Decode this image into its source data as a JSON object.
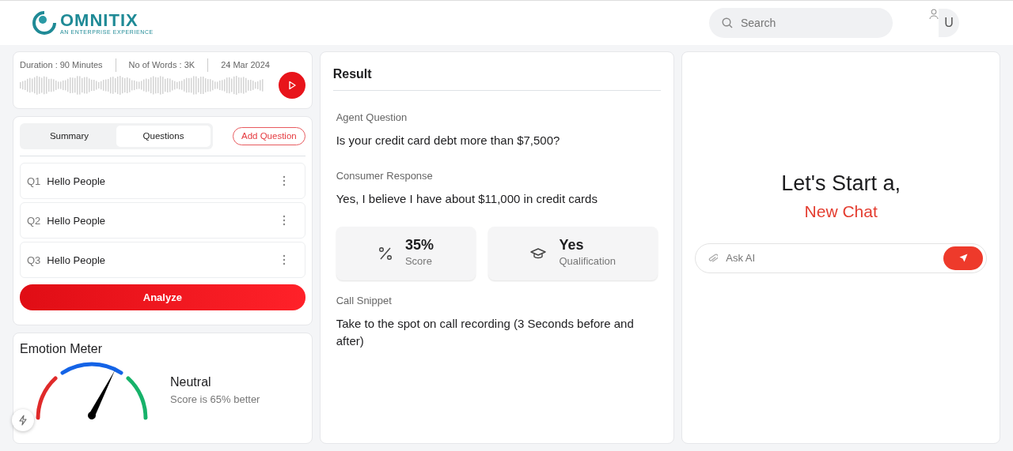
{
  "header": {
    "logo_name": "OMNITIX",
    "logo_tagline": "AN ENTERPRISE EXPERIENCE",
    "search": {
      "placeholder": "Search"
    },
    "avatar": "U"
  },
  "recording": {
    "meta": [
      "Duration : 90 Minutes",
      "No of Words : 3K",
      "24 Mar 2024"
    ]
  },
  "tabs": [
    {
      "label": "Summary",
      "selected": false
    },
    {
      "label": "Questions",
      "selected": true
    }
  ],
  "add_button": "Add Question",
  "questions": [
    {
      "number": "Q1",
      "text": "Hello People"
    },
    {
      "number": "Q2",
      "text": "Hello People"
    },
    {
      "number": "Q3",
      "text": "Hello People"
    }
  ],
  "analyze_button": "Analyze",
  "emotion_meter": {
    "title": "Emotion Meter",
    "mood": "Neutral",
    "note": "Score is 65% better"
  },
  "result": {
    "title": "Result",
    "sections": [
      {
        "label": "Agent Question",
        "text": "Is your credit card debt more than $7,500?"
      },
      {
        "label": "Consumer Response",
        "text": "Yes, I believe I have about $11,000 in credit cards"
      }
    ],
    "stats": [
      {
        "kind": "percent",
        "value": "35%",
        "label": "Score"
      },
      {
        "kind": "graduation",
        "value": "Yes",
        "label": "Qualification"
      }
    ],
    "snippet_label": "Call Snippet",
    "snippet_text": "Take to the spot on call recording (3 Seconds before and after)"
  },
  "chat": {
    "heading": "Let's Start a,",
    "highlight": "New Chat",
    "input": {
      "placeholder": "Ask AI"
    }
  }
}
